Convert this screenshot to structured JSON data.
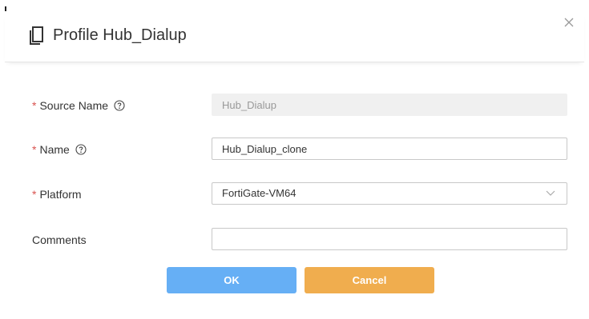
{
  "dialog": {
    "title": "Profile Hub_Dialup",
    "title_icon": "clone-document-icon",
    "close_icon": "close-icon"
  },
  "form": {
    "source_name": {
      "label": "Source Name",
      "required": "*",
      "value": "Hub_Dialup",
      "help_icon": "help-circle-icon"
    },
    "name": {
      "label": "Name",
      "required": "*",
      "value": "Hub_Dialup_clone",
      "help_icon": "help-circle-icon"
    },
    "platform": {
      "label": "Platform",
      "required": "*",
      "value": "FortiGate-VM64",
      "chevron_icon": "chevron-down-icon"
    },
    "comments": {
      "label": "Comments",
      "value": ""
    }
  },
  "buttons": {
    "ok_label": "OK",
    "cancel_label": "Cancel"
  },
  "colors": {
    "ok": "#66aff5",
    "cancel": "#f0ad4e",
    "required": "#d9534f"
  }
}
